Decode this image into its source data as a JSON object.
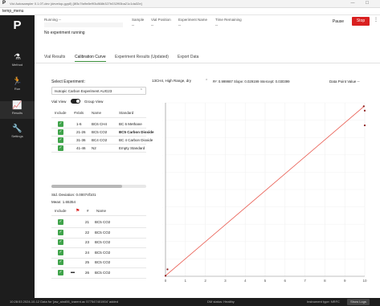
{
  "window": {
    "title": "Vici Autosampler 0.1.0T-dev (develop-gyp8) [8f3c7fa9e8ef93c868b327b032f93ba21c1da32e]",
    "menu": "temp_menu"
  },
  "sidebar": {
    "items": [
      {
        "label": "Method",
        "icon": "flask-icon",
        "glyph": "⚗"
      },
      {
        "label": "Run",
        "icon": "run-icon",
        "glyph": "🏃"
      },
      {
        "label": "Results",
        "icon": "chart-icon",
        "glyph": "📈"
      },
      {
        "label": "Settings",
        "icon": "wrench-icon",
        "glyph": "🔧"
      }
    ]
  },
  "status": {
    "running_label": "Running",
    "running_value": "--",
    "sample_label": "Sample",
    "sample_value": "--",
    "vial_position_label": "Vial Position",
    "vial_position_value": "--",
    "experiment_name_label": "Experiment Name",
    "experiment_name_value": "--",
    "time_remaining_label": "Time Remaining",
    "time_remaining_value": "--",
    "message": "No experiment running",
    "pause": "Pause",
    "stop": "Stop",
    "more": "⋮"
  },
  "tabs": [
    "Vial Results",
    "Calibration Curve",
    "Experiment Results (Updated)",
    "Export Data"
  ],
  "left": {
    "select_label": "Select Experiment:",
    "selected_experiment": "Isotopic Carbon Experiment AUG23",
    "vial_view": "Vial View",
    "group_view": "Group View",
    "table_headers": [
      "Include",
      "#Vials",
      "Name",
      "Standard"
    ],
    "rows": [
      {
        "vials": "1-6",
        "name": "BC6 CH4",
        "standard": "BC 6 Methane",
        "bold": false
      },
      {
        "vials": "21-26",
        "name": "BC5 CO2",
        "standard": "BC5 Carbon Dioxide",
        "bold": true
      },
      {
        "vials": "31-36",
        "name": "BC4 CO2",
        "standard": "BC 4 Carbon Dioxide",
        "bold": false
      },
      {
        "vials": "41-46",
        "name": "N2",
        "standard": "Empty Standard",
        "bold": false
      }
    ],
    "std_dev": "Std. Deviation: 0.00074f101",
    "mean": "Mean: 1.65354",
    "vial_headers": [
      "Include",
      "#",
      "Name"
    ],
    "vials": [
      {
        "num": "21",
        "name": "BC5 CO2"
      },
      {
        "num": "22",
        "name": "BC5 CO2"
      },
      {
        "num": "23",
        "name": "BC5 CO2"
      },
      {
        "num": "24",
        "name": "BC5 CO2"
      },
      {
        "num": "25",
        "name": "BC5 CO2"
      },
      {
        "num": "26",
        "name": "BC5 CO2"
      }
    ]
  },
  "chart": {
    "gas_select": "13CH4, High Range, dry",
    "stats": "R²: 0.999987  Slope: 0.029199  Intercept: 0.030399",
    "data_point_label": "Data Point Value",
    "data_point_value": "--"
  },
  "chart_data": {
    "type": "scatter",
    "x_ticks": [
      "0",
      "1",
      "2",
      "3",
      "4",
      "5",
      "6",
      "7",
      "8",
      "9",
      "10"
    ],
    "y_ticks": [],
    "xlim": [
      0,
      10
    ],
    "ylim": [
      0,
      10
    ],
    "points": [
      {
        "x": 0.0,
        "y": 0.03
      },
      {
        "x": 0.1,
        "y": 0.4
      },
      {
        "x": 9.95,
        "y": 9.8
      },
      {
        "x": 10.0,
        "y": 9.55
      },
      {
        "x": 10.0,
        "y": 8.7
      }
    ],
    "fit_line": {
      "slope": 0.98,
      "intercept": 0.03
    },
    "colors": {
      "points": "#8a1c1c",
      "line": "#e8554a"
    }
  },
  "statusbar": {
    "log": "10:28:53 2024-10-12 Data for 'jaw_aind06_ivarent.ac 577547401904' added",
    "status": "DM status: Healthy",
    "instrument": "Instrument type: NRFC",
    "show_logs": "Show Logs"
  }
}
